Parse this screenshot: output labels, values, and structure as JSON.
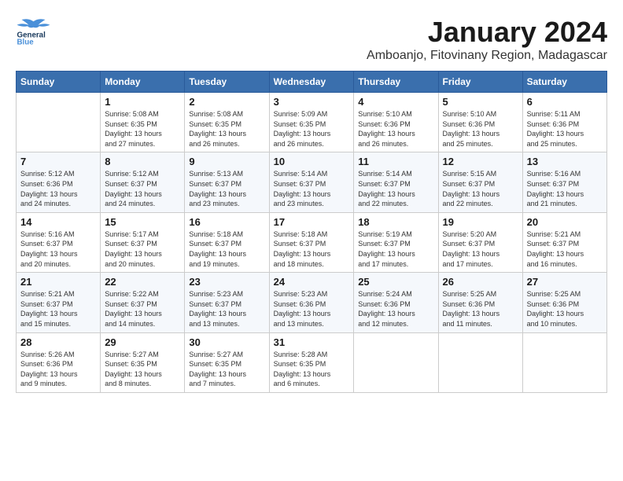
{
  "header": {
    "logo_general": "General",
    "logo_blue": "Blue",
    "month_title": "January 2024",
    "subtitle": "Amboanjo, Fitovinany Region, Madagascar"
  },
  "weekdays": [
    "Sunday",
    "Monday",
    "Tuesday",
    "Wednesday",
    "Thursday",
    "Friday",
    "Saturday"
  ],
  "weeks": [
    [
      {
        "day": "",
        "info": ""
      },
      {
        "day": "1",
        "info": "Sunrise: 5:08 AM\nSunset: 6:35 PM\nDaylight: 13 hours\nand 27 minutes."
      },
      {
        "day": "2",
        "info": "Sunrise: 5:08 AM\nSunset: 6:35 PM\nDaylight: 13 hours\nand 26 minutes."
      },
      {
        "day": "3",
        "info": "Sunrise: 5:09 AM\nSunset: 6:35 PM\nDaylight: 13 hours\nand 26 minutes."
      },
      {
        "day": "4",
        "info": "Sunrise: 5:10 AM\nSunset: 6:36 PM\nDaylight: 13 hours\nand 26 minutes."
      },
      {
        "day": "5",
        "info": "Sunrise: 5:10 AM\nSunset: 6:36 PM\nDaylight: 13 hours\nand 25 minutes."
      },
      {
        "day": "6",
        "info": "Sunrise: 5:11 AM\nSunset: 6:36 PM\nDaylight: 13 hours\nand 25 minutes."
      }
    ],
    [
      {
        "day": "7",
        "info": "Sunrise: 5:12 AM\nSunset: 6:36 PM\nDaylight: 13 hours\nand 24 minutes."
      },
      {
        "day": "8",
        "info": "Sunrise: 5:12 AM\nSunset: 6:37 PM\nDaylight: 13 hours\nand 24 minutes."
      },
      {
        "day": "9",
        "info": "Sunrise: 5:13 AM\nSunset: 6:37 PM\nDaylight: 13 hours\nand 23 minutes."
      },
      {
        "day": "10",
        "info": "Sunrise: 5:14 AM\nSunset: 6:37 PM\nDaylight: 13 hours\nand 23 minutes."
      },
      {
        "day": "11",
        "info": "Sunrise: 5:14 AM\nSunset: 6:37 PM\nDaylight: 13 hours\nand 22 minutes."
      },
      {
        "day": "12",
        "info": "Sunrise: 5:15 AM\nSunset: 6:37 PM\nDaylight: 13 hours\nand 22 minutes."
      },
      {
        "day": "13",
        "info": "Sunrise: 5:16 AM\nSunset: 6:37 PM\nDaylight: 13 hours\nand 21 minutes."
      }
    ],
    [
      {
        "day": "14",
        "info": "Sunrise: 5:16 AM\nSunset: 6:37 PM\nDaylight: 13 hours\nand 20 minutes."
      },
      {
        "day": "15",
        "info": "Sunrise: 5:17 AM\nSunset: 6:37 PM\nDaylight: 13 hours\nand 20 minutes."
      },
      {
        "day": "16",
        "info": "Sunrise: 5:18 AM\nSunset: 6:37 PM\nDaylight: 13 hours\nand 19 minutes."
      },
      {
        "day": "17",
        "info": "Sunrise: 5:18 AM\nSunset: 6:37 PM\nDaylight: 13 hours\nand 18 minutes."
      },
      {
        "day": "18",
        "info": "Sunrise: 5:19 AM\nSunset: 6:37 PM\nDaylight: 13 hours\nand 17 minutes."
      },
      {
        "day": "19",
        "info": "Sunrise: 5:20 AM\nSunset: 6:37 PM\nDaylight: 13 hours\nand 17 minutes."
      },
      {
        "day": "20",
        "info": "Sunrise: 5:21 AM\nSunset: 6:37 PM\nDaylight: 13 hours\nand 16 minutes."
      }
    ],
    [
      {
        "day": "21",
        "info": "Sunrise: 5:21 AM\nSunset: 6:37 PM\nDaylight: 13 hours\nand 15 minutes."
      },
      {
        "day": "22",
        "info": "Sunrise: 5:22 AM\nSunset: 6:37 PM\nDaylight: 13 hours\nand 14 minutes."
      },
      {
        "day": "23",
        "info": "Sunrise: 5:23 AM\nSunset: 6:37 PM\nDaylight: 13 hours\nand 13 minutes."
      },
      {
        "day": "24",
        "info": "Sunrise: 5:23 AM\nSunset: 6:36 PM\nDaylight: 13 hours\nand 13 minutes."
      },
      {
        "day": "25",
        "info": "Sunrise: 5:24 AM\nSunset: 6:36 PM\nDaylight: 13 hours\nand 12 minutes."
      },
      {
        "day": "26",
        "info": "Sunrise: 5:25 AM\nSunset: 6:36 PM\nDaylight: 13 hours\nand 11 minutes."
      },
      {
        "day": "27",
        "info": "Sunrise: 5:25 AM\nSunset: 6:36 PM\nDaylight: 13 hours\nand 10 minutes."
      }
    ],
    [
      {
        "day": "28",
        "info": "Sunrise: 5:26 AM\nSunset: 6:36 PM\nDaylight: 13 hours\nand 9 minutes."
      },
      {
        "day": "29",
        "info": "Sunrise: 5:27 AM\nSunset: 6:35 PM\nDaylight: 13 hours\nand 8 minutes."
      },
      {
        "day": "30",
        "info": "Sunrise: 5:27 AM\nSunset: 6:35 PM\nDaylight: 13 hours\nand 7 minutes."
      },
      {
        "day": "31",
        "info": "Sunrise: 5:28 AM\nSunset: 6:35 PM\nDaylight: 13 hours\nand 6 minutes."
      },
      {
        "day": "",
        "info": ""
      },
      {
        "day": "",
        "info": ""
      },
      {
        "day": "",
        "info": ""
      }
    ]
  ]
}
